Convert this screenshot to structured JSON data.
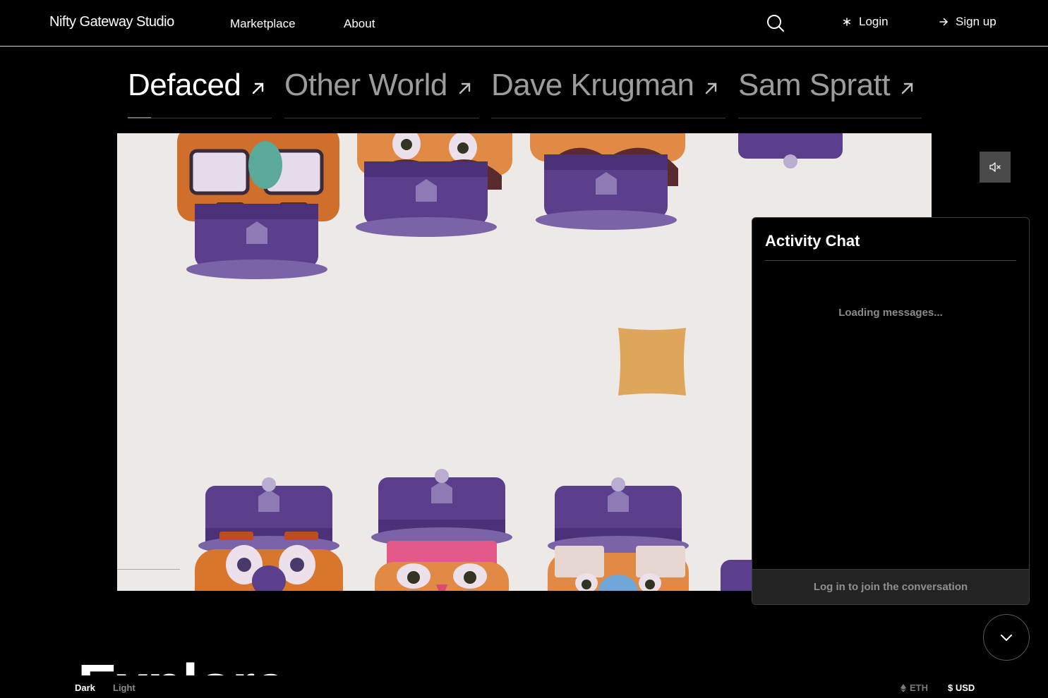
{
  "header": {
    "logo": "Nifty Gateway Studio",
    "nav": {
      "marketplace": "Marketplace",
      "about": "About"
    },
    "login": "Login",
    "signup": "Sign up"
  },
  "tabs": [
    {
      "label": "Defaced",
      "active": true
    },
    {
      "label": "Other World",
      "active": false
    },
    {
      "label": "Dave Krugman",
      "active": false
    },
    {
      "label": "Sam Spratt",
      "active": false
    }
  ],
  "chat": {
    "title": "Activity Chat",
    "loading": "Loading messages...",
    "footer": "Log in to join the conversation"
  },
  "explore": {
    "heading": "Explore"
  },
  "footer": {
    "theme_dark": "Dark",
    "theme_light": "Light",
    "currency_eth": "ETH",
    "currency_usd": "$ USD"
  },
  "colors": {
    "background": "#000000",
    "hero_bg": "#ece9e7",
    "purple": "#5b3f8c",
    "orange": "#e0883c",
    "tan_star": "#dfa55a"
  },
  "icons": [
    "search-icon",
    "asterisk-icon",
    "arrow-right-icon",
    "arrow-up-right-icon",
    "mute-icon",
    "chevron-down-icon",
    "eth-icon"
  ]
}
